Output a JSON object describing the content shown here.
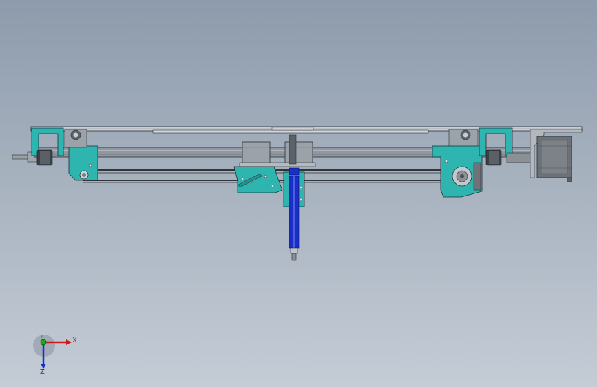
{
  "viewport": {
    "background_top": "#8d9bac",
    "background_bottom": "#c4ccd6"
  },
  "colors": {
    "bracket": "#2fb5b0",
    "bracket_dark": "#1f7f7c",
    "rod": "#8a8f96",
    "belt": "#3a3f44",
    "frame": "#bfc5cc",
    "motor": "#6d7278",
    "tool_blue": "#1a2fc8",
    "outline": "#2a2f34"
  },
  "triad": {
    "x_label": "X",
    "y_label": "Y",
    "z_label": "Z",
    "x_color": "#cc1a1a",
    "y_color": "#1aa81a",
    "z_color": "#1a2fc8"
  }
}
